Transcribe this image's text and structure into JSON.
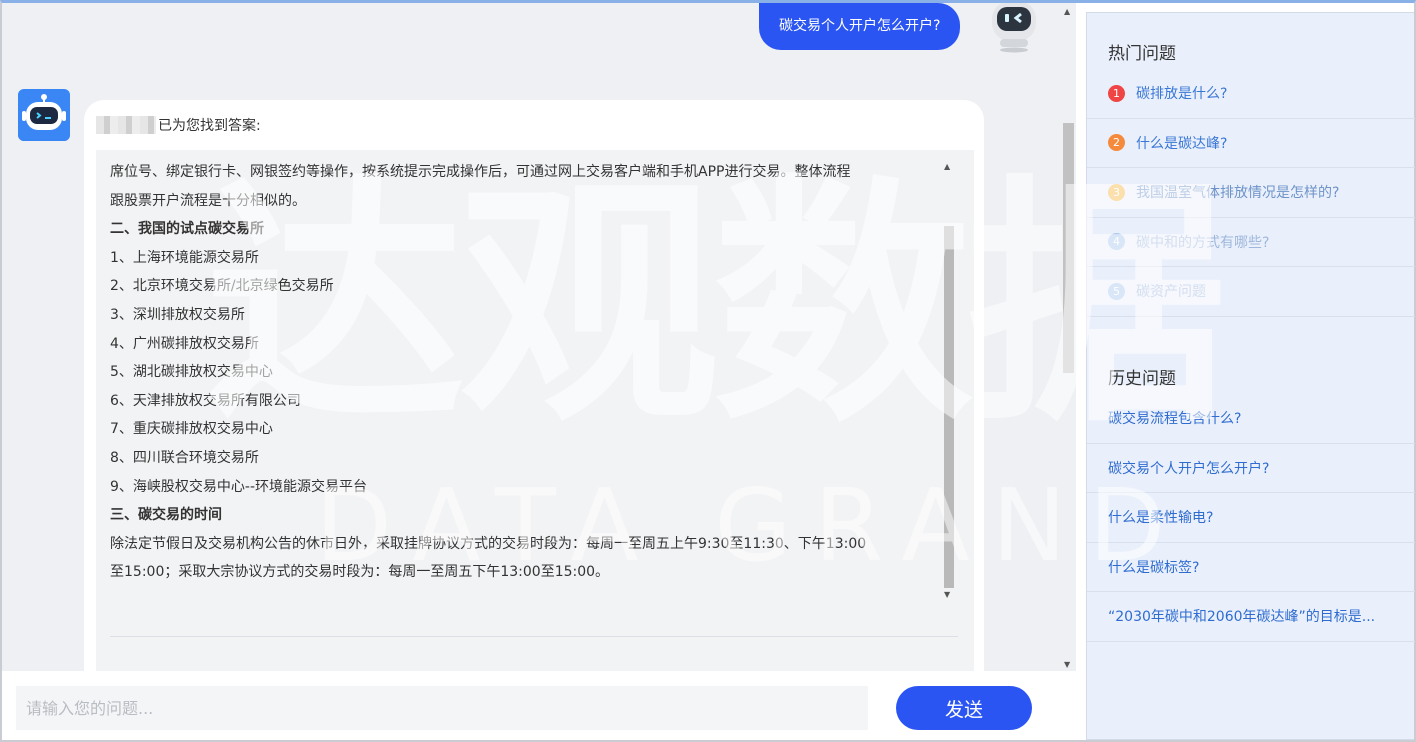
{
  "chat": {
    "user_question": "碳交易个人开户怎么开户?",
    "answer_header": "已为您找到答案:",
    "answer_lines": [
      {
        "text": "席位号、绑定银行卡、网银签约等操作，按系统提示完成操作后，可通过网上交易客户端和手机APP进行交易。整体流程",
        "bold": false
      },
      {
        "text": "跟股票开户流程是十分相似的。",
        "bold": false
      },
      {
        "text": "二、我国的试点碳交易所",
        "bold": true
      },
      {
        "text": "1、上海环境能源交易所",
        "bold": false
      },
      {
        "text": "2、北京环境交易所/北京绿色交易所",
        "bold": false
      },
      {
        "text": "3、深圳排放权交易所",
        "bold": false
      },
      {
        "text": "4、广州碳排放权交易所",
        "bold": false
      },
      {
        "text": "5、湖北碳排放权交易中心",
        "bold": false
      },
      {
        "text": "6、天津排放权交易所有限公司",
        "bold": false
      },
      {
        "text": "7、重庆碳排放权交易中心",
        "bold": false
      },
      {
        "text": "8、四川联合环境交易所",
        "bold": false
      },
      {
        "text": "9、海峡股权交易中心--环境能源交易平台",
        "bold": false
      },
      {
        "text": "三、碳交易的时间",
        "bold": true
      },
      {
        "text": "除法定节假日及交易机构公告的休市日外，采取挂牌协议方式的交易时段为：每周一至周五上午9:30至11:30、下午13:00",
        "bold": false
      },
      {
        "text": "至15:00；采取大宗协议方式的交易时段为：每周一至周五下午13:00至15:00。",
        "bold": false
      }
    ]
  },
  "input": {
    "placeholder": "请输入您的问题...",
    "send_label": "发送"
  },
  "sidebar": {
    "hot_title": "热门问题",
    "hot_items": [
      {
        "num": "1",
        "label": "碳排放是什么?",
        "color": "#f04545"
      },
      {
        "num": "2",
        "label": "什么是碳达峰?",
        "color": "#f58a3c"
      },
      {
        "num": "3",
        "label": "我国温室气体排放情况是怎样的?",
        "color": "#f7b84a"
      },
      {
        "num": "4",
        "label": "碳中和的方式有哪些?",
        "color": "#a9c7ef"
      },
      {
        "num": "5",
        "label": "碳资产问题",
        "color": "#a9c7ef"
      }
    ],
    "history_title": "历史问题",
    "history_items": [
      "碳交易流程包含什么?",
      "碳交易个人开户怎么开户?",
      "什么是柔性输电?",
      "什么是碳标签?",
      "“2030年碳中和2060年碳达峰”的目标是..."
    ]
  },
  "watermark": {
    "cn": "达观数据",
    "en": "DATA GRAND"
  },
  "colors": {
    "primary": "#2b55f2",
    "link": "#3a77d6",
    "sidebar_bg": "#eaf0fb",
    "chat_bg": "#eef0f3"
  }
}
